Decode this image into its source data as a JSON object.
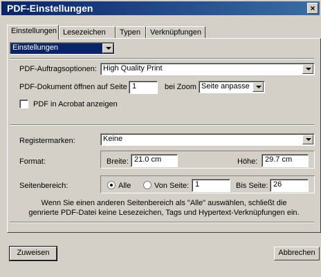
{
  "window": {
    "title": "PDF-Einstellungen",
    "close": "×"
  },
  "tabs": [
    {
      "label": "Einstellungen",
      "active": true
    },
    {
      "label": "Lesezeichen",
      "active": false
    },
    {
      "label": "Typen",
      "active": false
    },
    {
      "label": "Verknüpfungen",
      "active": false
    }
  ],
  "section_select": {
    "value": "Einstellungen"
  },
  "job_options": {
    "label": "PDF-Auftragsoptionen:",
    "value": "High Quality Print"
  },
  "open_page": {
    "label": "PDF-Dokument öffnen auf Seite",
    "value": "1",
    "zoom_label": "bei Zoom",
    "zoom_value": "Seite anpasse"
  },
  "acrobat": {
    "label": "PDF in Acrobat anzeigen",
    "checked": false
  },
  "registration": {
    "label": "Registermarken:",
    "value": "Keine"
  },
  "format": {
    "label": "Format:",
    "width_label": "Breite:",
    "width_value": "21.0 cm",
    "height_label": "Höhe:",
    "height_value": "29.7 cm"
  },
  "page_range": {
    "label": "Seitenbereich:",
    "all_label": "Alle",
    "from_label": "Von Seite:",
    "from_value": "1",
    "to_label": "Bis Seite:",
    "to_value": "26",
    "selected": "Alle"
  },
  "info": {
    "line1": "Wenn Sie einen anderen Seitenbereich als \"Alle\" auswählen, schließt die",
    "line2": "genrierte PDF-Datei keine Lesezeichen, Tags und Hypertext-Verknüpfungen ein."
  },
  "buttons": {
    "apply": "Zuweisen",
    "cancel": "Abbrechen"
  }
}
